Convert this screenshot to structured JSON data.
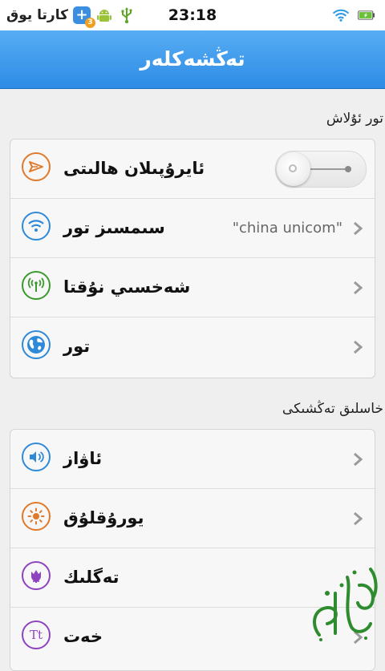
{
  "status_bar": {
    "carrier": "كارتا يوق",
    "notification_count": "3",
    "time": "23:18",
    "icons": [
      "carrier-badge-icon",
      "android-icon",
      "usb-icon",
      "wifi-icon",
      "battery-charging-icon"
    ]
  },
  "title_bar": {
    "title": "تەڭشەكلەر"
  },
  "sections": [
    {
      "header": "تور ئۇلاش",
      "items": [
        {
          "label": "ئايرۇپىلان ھالىتى",
          "icon": "airplane-icon",
          "color": "#e07a2a",
          "control": "toggle",
          "toggle_state": "off"
        },
        {
          "label": "سىمسىز تور",
          "icon": "wifi-icon",
          "color": "#2e8ad8",
          "value": "\"china unicom\"",
          "control": "chevron"
        },
        {
          "label": "شەخسىي نۇقتا",
          "icon": "hotspot-icon",
          "color": "#3a9a2e",
          "control": "chevron"
        },
        {
          "label": "تور",
          "icon": "globe-icon",
          "color": "#2e8ad8",
          "control": "chevron"
        }
      ]
    },
    {
      "header": "خاسلىق تەڭشىكى",
      "items": [
        {
          "label": "ئاۋاز",
          "icon": "speaker-icon",
          "color": "#2e8ad8",
          "control": "chevron"
        },
        {
          "label": "يورۇقلۇق",
          "icon": "brightness-icon",
          "color": "#e07a2a",
          "control": "chevron"
        },
        {
          "label": "تەگلىك",
          "icon": "flower-icon",
          "color": "#8e44c0",
          "control": "chevron"
        },
        {
          "label": "خەت",
          "icon": "font-icon",
          "color": "#8e44c0",
          "icon_text": "Tt",
          "control": "chevron"
        }
      ]
    }
  ],
  "watermark": {
    "icon": "calligraphy-logo-icon",
    "color": "#2e8b2e"
  }
}
